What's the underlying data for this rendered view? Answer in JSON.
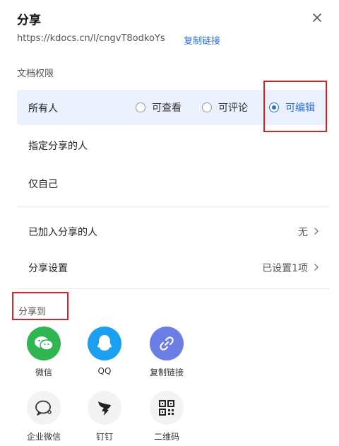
{
  "dialog": {
    "title": "分享"
  },
  "link": {
    "url": "https://kdocs.cn/l/cngvT8odkoYs",
    "copy_label": "复制链接"
  },
  "permissions": {
    "section_label": "文档权限",
    "everyone_label": "所有人",
    "options": [
      {
        "label": "可查看",
        "checked": false
      },
      {
        "label": "可评论",
        "checked": false
      },
      {
        "label": "可编辑",
        "checked": true
      }
    ],
    "specified_label": "指定分享的人",
    "self_label": "仅自己"
  },
  "settings": {
    "joined_label": "已加入分享的人",
    "joined_value": "无",
    "share_settings_label": "分享设置",
    "share_settings_value": "已设置1项"
  },
  "share_to": {
    "section_label": "分享到",
    "targets": [
      {
        "label": "微信",
        "icon": "wechat-icon",
        "color": "#2fb552"
      },
      {
        "label": "QQ",
        "icon": "qq-icon",
        "color": "#1a9ff1"
      },
      {
        "label": "复制链接",
        "icon": "link-icon",
        "color": "#6a7ee6"
      },
      {
        "label": "企业微信",
        "icon": "wecom-icon",
        "color": "#f2f3f5"
      },
      {
        "label": "钉钉",
        "icon": "dingtalk-icon",
        "color": "#f2f3f5"
      },
      {
        "label": "二维码",
        "icon": "qrcode-icon",
        "color": "#f2f3f5"
      }
    ]
  },
  "colors": {
    "accent": "#2b6de0",
    "highlight": "#e02020",
    "selected_row_bg": "#eaf1fd"
  }
}
